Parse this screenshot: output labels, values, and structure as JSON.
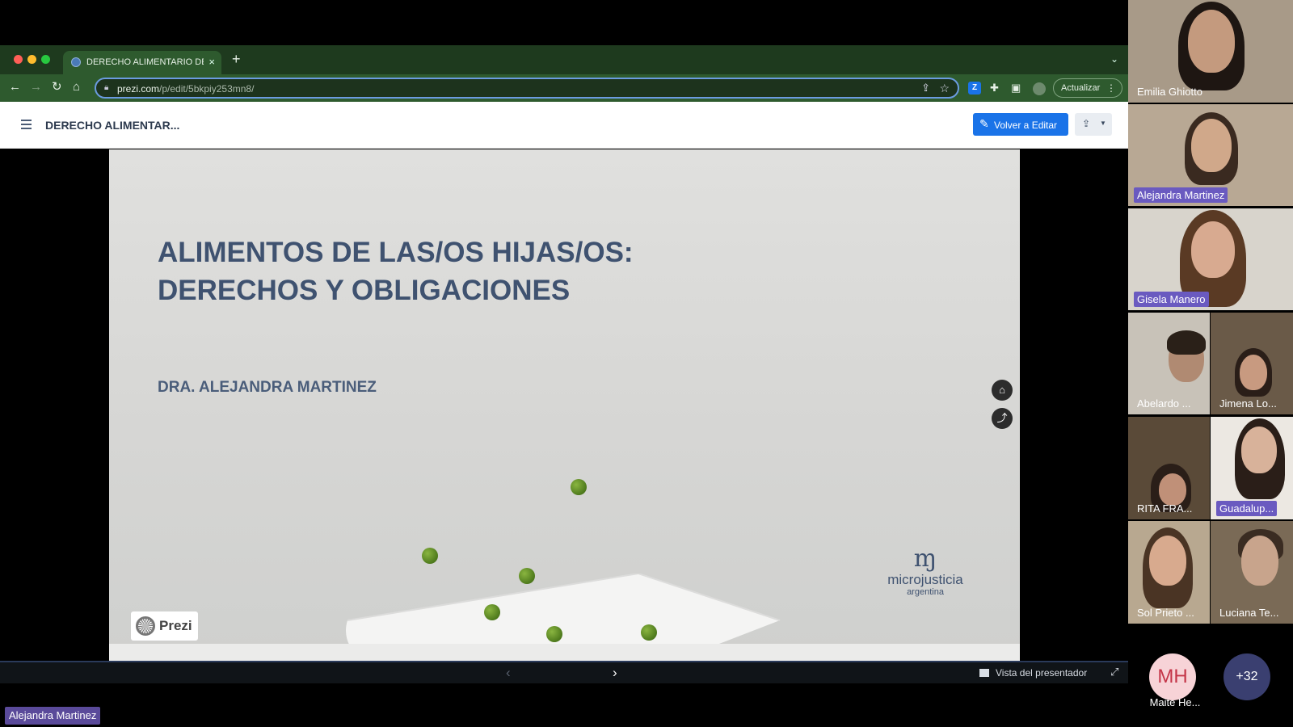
{
  "browser": {
    "tab_title": "DERECHO ALIMENTARIO DE D",
    "url_host": "prezi.com",
    "url_path": "/p/edit/5bkpiy253mn8/",
    "update_label": "Actualizar",
    "ext_z_label": "Z"
  },
  "prezi": {
    "presentation_title": "DERECHO ALIMENTAR...",
    "edit_button_label": "Volver a Editar",
    "presenter_view_label": "Vista del presentador",
    "logo_label": "Prezi"
  },
  "slide": {
    "title_line1": "ALIMENTOS DE LAS/OS HIJAS/OS:",
    "title_line2": "DERECHOS Y OBLIGACIONES",
    "author": "DRA. ALEJANDRA MARTINEZ",
    "brand_name": "microjusticia",
    "brand_sub": "argentina"
  },
  "meeting": {
    "active_speaker": "Alejandra Martinez",
    "participants": [
      {
        "name": "Emilia Ghiotto"
      },
      {
        "name": "Alejandra Martinez"
      },
      {
        "name": "Gisela Manero"
      },
      {
        "name": "Abelardo ..."
      },
      {
        "name": "Jimena Lo..."
      },
      {
        "name": "RITA FRA..."
      },
      {
        "name": "Guadalup..."
      },
      {
        "name": "Sol Prieto ..."
      },
      {
        "name": "Luciana Te..."
      }
    ],
    "avatar_initials": "MH",
    "avatar_name": "Maite He...",
    "more_count": "+32"
  },
  "colors": {
    "browser_frame": "#2e5a2e",
    "accent": "#1a73e8",
    "slide_text": "#3f5270",
    "speaker_tag": "#5a4a9a"
  }
}
